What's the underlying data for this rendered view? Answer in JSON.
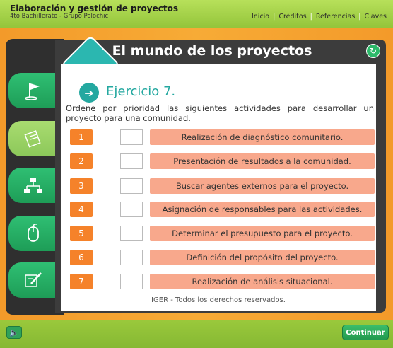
{
  "header": {
    "app_title": "Elaboración y gestión de proyectos",
    "app_subtitle": "4to Bachillerato - Grupo Polochic",
    "nav": [
      "Inicio",
      "Créditos",
      "Referencias",
      "Claves"
    ]
  },
  "panel": {
    "title": "El mundo de los proyectos"
  },
  "exercise": {
    "title": "Ejercicio 7.",
    "instructions": "Ordene por prioridad las siguientes actividades para desarrollar un proyecto para una comunidad.",
    "rows": [
      {
        "num": "1",
        "activity": "Realización de diagnóstico comunitario."
      },
      {
        "num": "2",
        "activity": "Presentación de resultados a la comunidad."
      },
      {
        "num": "3",
        "activity": "Buscar agentes externos para el proyecto."
      },
      {
        "num": "4",
        "activity": "Asignación de responsables para las actividades."
      },
      {
        "num": "5",
        "activity": "Determinar el presupuesto para el proyecto."
      },
      {
        "num": "6",
        "activity": "Definición del propósito del proyecto."
      },
      {
        "num": "7",
        "activity": "Realización de análisis situacional."
      }
    ],
    "footer": "IGER - Todos los derechos reservados."
  },
  "bottom": {
    "continue_label": "Continuar"
  },
  "icons": {
    "refresh": "refresh-icon",
    "sound": "speaker-icon",
    "exercise_arrow": "arrow-right-icon"
  }
}
